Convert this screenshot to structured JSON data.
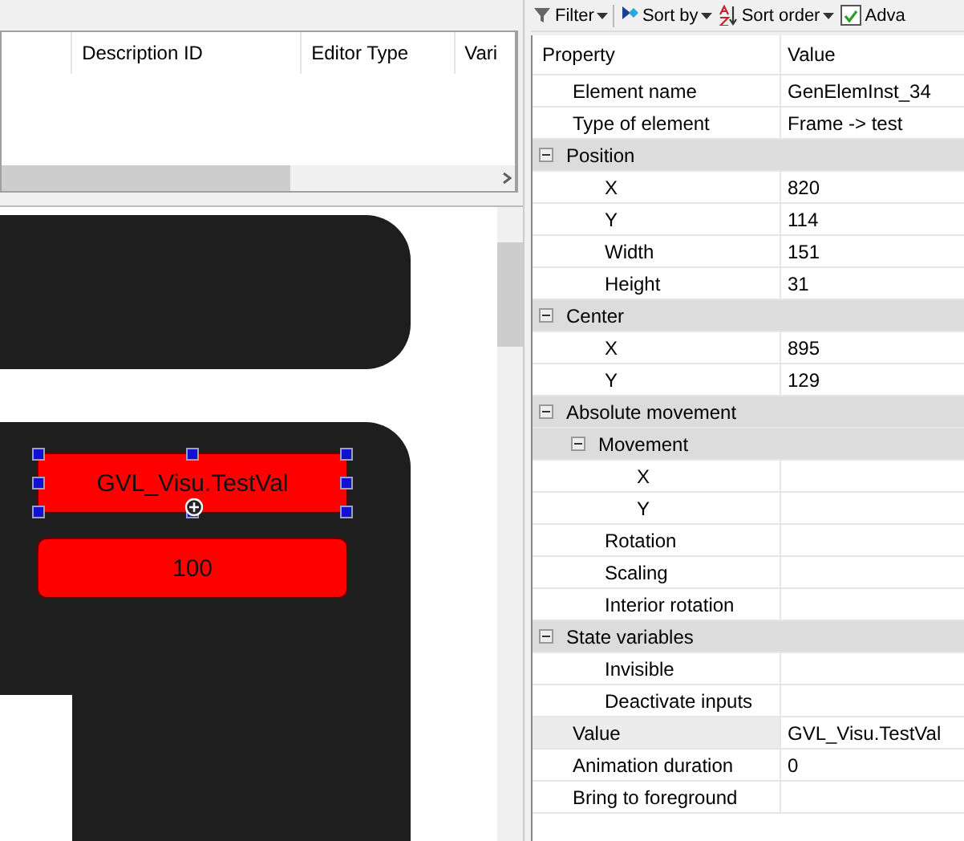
{
  "table": {
    "columns": [
      "Description ID",
      "Editor Type",
      "Vari"
    ]
  },
  "canvas": {
    "elements": [
      {
        "text": "GVL_Visu.TestVal",
        "selected": true
      },
      {
        "text": "100",
        "selected": false
      }
    ]
  },
  "toolbar": [
    {
      "kind": "dropdown",
      "label": "Filter"
    },
    {
      "kind": "dropdown",
      "label": "Sort by"
    },
    {
      "kind": "dropdown",
      "label": "Sort order"
    },
    {
      "kind": "checkbox",
      "label": "Adva",
      "checked": true
    }
  ],
  "grid": {
    "columns": [
      "Property",
      "Value"
    ],
    "rows": [
      {
        "kind": "property",
        "name": "Element name",
        "value": "GenElemInst_34"
      },
      {
        "kind": "property",
        "name": "Type of element",
        "value": "Frame -> test"
      },
      {
        "kind": "category",
        "name": "Position",
        "expanded": true,
        "children": [
          {
            "kind": "property",
            "name": "X",
            "value": "820"
          },
          {
            "kind": "property",
            "name": "Y",
            "value": "114"
          },
          {
            "kind": "property",
            "name": "Width",
            "value": "151"
          },
          {
            "kind": "property",
            "name": "Height",
            "value": "31"
          }
        ]
      },
      {
        "kind": "category",
        "name": "Center",
        "expanded": true,
        "children": [
          {
            "kind": "property",
            "name": "X",
            "value": "895"
          },
          {
            "kind": "property",
            "name": "Y",
            "value": "129"
          }
        ]
      },
      {
        "kind": "category",
        "name": "Absolute movement",
        "expanded": true,
        "children": [
          {
            "kind": "category",
            "name": "Movement",
            "expanded": true,
            "children": [
              {
                "kind": "property",
                "name": "X"
              },
              {
                "kind": "property",
                "name": "Y"
              }
            ]
          },
          {
            "kind": "property",
            "name": "Rotation"
          },
          {
            "kind": "property",
            "name": "Scaling"
          },
          {
            "kind": "property",
            "name": "Interior rotation"
          }
        ]
      },
      {
        "kind": "category",
        "name": "State variables",
        "expanded": true,
        "children": [
          {
            "kind": "property",
            "name": "Invisible"
          },
          {
            "kind": "property",
            "name": "Deactivate inputs"
          }
        ]
      },
      {
        "kind": "property",
        "name": "Value",
        "value": "GVL_Visu.TestVal",
        "selected": true
      },
      {
        "kind": "property",
        "name": "Animation duration",
        "value": "0"
      },
      {
        "kind": "property",
        "name": "Bring to foreground"
      }
    ]
  }
}
